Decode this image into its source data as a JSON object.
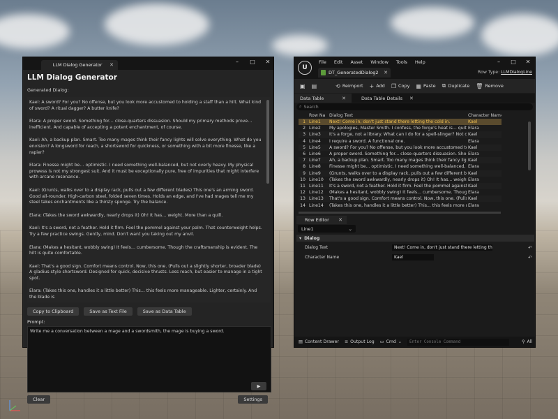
{
  "left_window": {
    "tab_label": "LLM Dialog Generator",
    "title": "LLM Dialog Generator",
    "generated_label": "Generated Dialog:",
    "dialog_lines": [
      "Kael: A sword? For you? No offense, but you look more accustomed to holding a staff than a hilt. What kind of sword? A ritual dagger? A butter knife?",
      "Elara: A proper sword. Something for… close-quarters dissuasion. Should my primary methods prove… inefficient. And capable of accepting a potent enchantment, of course.",
      "Kael: Ah, a backup plan. Smart. Too many mages think their fancy lights will solve everything. What do you envision? A longsword for reach, a shortsword for quickness, or something with a bit more finesse, like a rapier?",
      "Elara: Finesse might be… optimistic. I need something well-balanced, but not overly heavy. My physical prowess is not my strongest suit. And it must be exceptionally pure, free of impurities that might interfere with arcane resonance.",
      "Kael: (Grunts, walks over to a display rack, pulls out a few different blades) This one's an arming sword. Good all-rounder. High-carbon steel, folded seven times. Holds an edge, and I've had mages tell me my steel takes enchantments like a thirsty sponge. Try the balance.",
      "Elara: (Takes the sword awkwardly, nearly drops it) Oh! It has… weight. More than a quill.",
      "Kael: It's a sword, not a feather. Hold it firm. Feel the pommel against your palm. That counterweight helps. Try a few practice swings. Gently, mind. Don't want you taking out my anvil.",
      "Elara: (Makes a hesitant, wobbly swing) It feels… cumbersome. Though the craftsmanship is evident. The hilt is quite comfortable.",
      "Kael: That's a good sign. Comfort means control. Now, this one. (Pulls out a slightly shorter, broader blade) A gladius-style shortsword. Designed for quick, decisive thrusts. Less reach, but easier to manage in a tight spot.",
      "Elara: (Takes this one, handles it a little better) This… this feels more manageable. Lighter, certainly. And the blade is"
    ],
    "buttons": {
      "copy": "Copy to Clipboard",
      "save_text": "Save as Text File",
      "save_table": "Save as Data Table",
      "clear": "Clear",
      "settings": "Settings",
      "send": "▶"
    },
    "prompt_label": "Prompt:",
    "prompt_value": "Write me a conversation between a mage and a swordsmith, the mage is buying a sword."
  },
  "right_window": {
    "menu": [
      "File",
      "Edit",
      "Asset",
      "Window",
      "Tools",
      "Help"
    ],
    "asset_tab": "DT_GeneratedDialog2",
    "row_type_label": "Row Type:",
    "row_type_value": "LLMDialogLine",
    "toolbar": [
      "Reimport",
      "Add",
      "Copy",
      "Paste",
      "Duplicate",
      "Remove"
    ],
    "subtabs": [
      "Data Table",
      "Data Table Details"
    ],
    "search_placeholder": "Search",
    "columns": [
      "Row Na",
      "Dialog Text",
      "Character Name"
    ],
    "rows": [
      {
        "num": "1",
        "name": "Line1",
        "dialog": "Next! Come in, don't just stand there letting the cold in.",
        "char": "Kael"
      },
      {
        "num": "2",
        "name": "Line2",
        "dialog": "My apologies, Master Smith. I confess, the forge's heat is... quite intense.",
        "char": "Elara"
      },
      {
        "num": "3",
        "name": "Line3",
        "dialog": "It's a forge, not a library. What can I do for a spell-slinger? Not often I see",
        "char": "Kael"
      },
      {
        "num": "4",
        "name": "Line4",
        "dialog": "I require a sword. A functional one.",
        "char": "Elara"
      },
      {
        "num": "5",
        "name": "Line5",
        "dialog": "A sword? For you? No offense, but you look more accustomed to holding",
        "char": "Kael"
      },
      {
        "num": "6",
        "name": "Line6",
        "dialog": "A proper sword. Something for... close-quarters dissuasion. Should my p",
        "char": "Elara"
      },
      {
        "num": "7",
        "name": "Line7",
        "dialog": "Ah, a backup plan. Smart. Too many mages think their fancy lights will s",
        "char": "Kael"
      },
      {
        "num": "8",
        "name": "Line8",
        "dialog": "Finesse might be... optimistic. I need something well-balanced, but not ov",
        "char": "Elara"
      },
      {
        "num": "9",
        "name": "Line9",
        "dialog": "(Grunts, walks over to a display rack, pulls out a few different blades) This",
        "char": "Kael"
      },
      {
        "num": "10",
        "name": "Line10",
        "dialog": "(Takes the sword awkwardly, nearly drops it) Oh! It has... weight. More th",
        "char": "Elara"
      },
      {
        "num": "11",
        "name": "Line11",
        "dialog": "It's a sword, not a feather. Hold it firm. Feel the pommel against your pal",
        "char": "Kael"
      },
      {
        "num": "12",
        "name": "Line12",
        "dialog": "(Makes a hesitant, wobbly swing) It feels... cumbersome. Though the craft",
        "char": "Elara"
      },
      {
        "num": "13",
        "name": "Line13",
        "dialog": "That's a good sign. Comfort means control. Now, this one. (Pulls out a sli",
        "char": "Kael"
      },
      {
        "num": "14",
        "name": "Line14",
        "dialog": "(Takes this one, handles it a little better) This... this feels more manageab",
        "char": "Elara"
      }
    ],
    "row_editor_tab": "Row Editor",
    "row_select": "Line1",
    "section_label": "Dialog",
    "props": [
      {
        "label": "Dialog Text",
        "value": "Next! Come in, don't just stand there letting the cold in."
      },
      {
        "label": "Character Name",
        "value": "Kael"
      }
    ],
    "status": {
      "content_drawer": "Content Drawer",
      "output_log": "Output Log",
      "cmd": "Cmd",
      "console_placeholder": "Enter Console Command",
      "all": "All"
    }
  }
}
